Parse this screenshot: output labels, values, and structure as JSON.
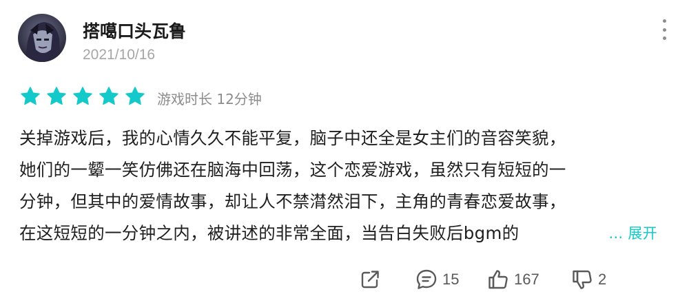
{
  "user": {
    "name": "搭噶口头瓦鲁",
    "avatar_icon": "avatar-icon"
  },
  "date": "2021/10/16",
  "menu_icon": "more-vertical-icon",
  "rating": {
    "stars": 5,
    "max": 5,
    "color": "#14c9c9"
  },
  "playtime": "游戏时长 12分钟",
  "review": {
    "lines": [
      "关掉游戏后，我的心情久久不能平复，脑子中还全是女主们的音容笑貌，",
      "她们的一颦一笑仿佛还在脑海中回荡，这个恋爱游戏，虽然只有短短的一",
      "分钟，但其中的爱情故事，却让人不禁潸然泪下，主角的青春恋爱故事，",
      "在这短短的一分钟之内，被讲述的非常全面，当告白失败后bgm的"
    ],
    "expand_label": "... 展开"
  },
  "actions": {
    "share": {
      "icon": "share-icon"
    },
    "comment": {
      "icon": "comment-icon",
      "count": "15"
    },
    "like": {
      "icon": "thumbs-up-icon",
      "count": "167"
    },
    "dislike": {
      "icon": "thumbs-down-icon",
      "count": "2"
    }
  }
}
